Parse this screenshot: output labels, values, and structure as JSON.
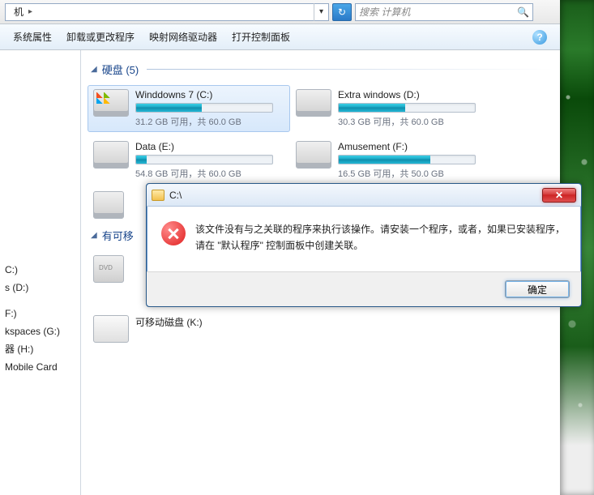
{
  "addressbar": {
    "segment": "机",
    "segment_arrow": "▸",
    "dropdown_glyph": "▾",
    "refresh_glyph": "↻"
  },
  "search": {
    "placeholder": "搜索 计算机",
    "icon_glyph": "🔍"
  },
  "toolbar": {
    "items": [
      {
        "label": "系统属性"
      },
      {
        "label": "卸载或更改程序"
      },
      {
        "label": "映射网络驱动器"
      },
      {
        "label": "打开控制面板"
      }
    ],
    "help_glyph": "?"
  },
  "nav": {
    "items": [
      "C:)",
      "s (D:)",
      "F:)",
      "kspaces (G:)",
      "器 (H:)",
      "Mobile Card"
    ]
  },
  "groups": {
    "hdd_label": "硬盘 (5)",
    "removable_label": "有可移"
  },
  "drives_hdd": [
    {
      "name": "Winddowns 7 (C:)",
      "stats": "31.2 GB 可用，共 60.0 GB",
      "fill_pct": 48,
      "selected": true,
      "win": true
    },
    {
      "name": "Extra windows (D:)",
      "stats": "30.3 GB 可用，共 60.0 GB",
      "fill_pct": 49
    },
    {
      "name": "Data (E:)",
      "stats": "54.8 GB 可用，共 60.0 GB",
      "fill_pct": 8
    },
    {
      "name": "Amusement (F:)",
      "stats": "16.5 GB 可用，共 50.0 GB",
      "fill_pct": 67
    }
  ],
  "removable_label": "可移动磁盘 (K:)",
  "dialog": {
    "title": "C:\\",
    "message": "该文件没有与之关联的程序来执行该操作。请安装一个程序，或者，如果已安装程序，请在 \"默认程序\" 控制面板中创建关联。",
    "ok_label": "确定",
    "close_glyph": "✕"
  }
}
